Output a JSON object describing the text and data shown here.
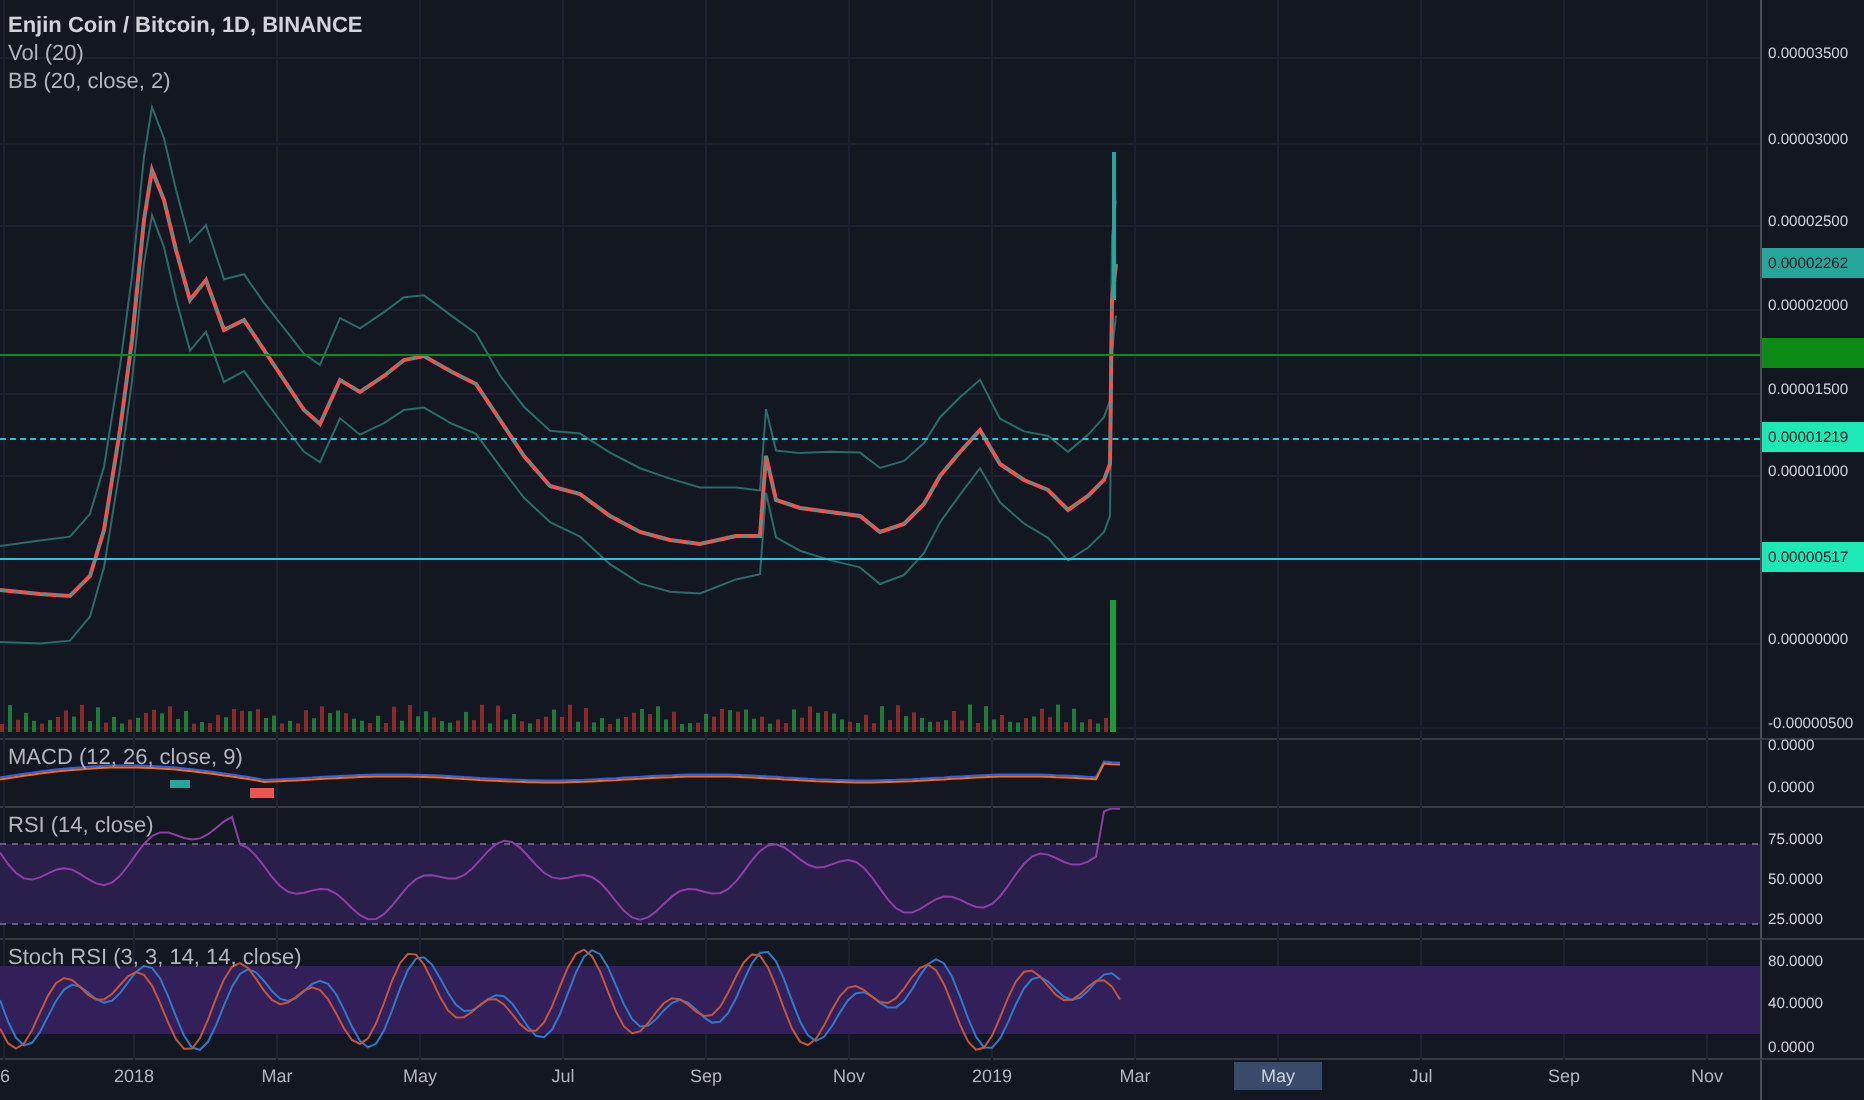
{
  "legend": {
    "title": "Enjin Coin / Bitcoin, 1D, BINANCE",
    "studies": [
      "Vol (20)",
      "BB (20, close, 2)"
    ]
  },
  "price_axis": {
    "ticks": [
      "0.00003500",
      "0.00003000",
      "0.00002500",
      "0.00002000",
      "0.00001500",
      "0.00001000",
      "0.00000000",
      "-0.00000500"
    ]
  },
  "price_lines": [
    {
      "kind": "solid",
      "color": "#0e8a16"
    },
    {
      "kind": "dashed",
      "color": "#26c6da"
    },
    {
      "kind": "solid",
      "color": "#26c6da"
    }
  ],
  "price_tags": [
    {
      "text": "0.00002262",
      "color": "#26a69a"
    },
    {
      "text": "0.00001219",
      "color": "#1de9b6"
    },
    {
      "text": "0.00000517",
      "color": "#1de9b6"
    }
  ],
  "panes": [
    {
      "kind": "macd",
      "label": "MACD (12, 26, close, 9)",
      "ticks": [
        "0.0000",
        "0.0000"
      ]
    },
    {
      "kind": "rsi",
      "label": "RSI (14, close)",
      "ticks": [
        "75.0000",
        "50.0000",
        "25.0000"
      ]
    },
    {
      "kind": "stoch",
      "label": "Stoch RSI (3, 3, 14, 14, close)",
      "ticks": [
        "80.0000",
        "40.0000",
        "0.0000"
      ]
    }
  ],
  "time_axis": [
    {
      "label": "6",
      "selected": false
    },
    {
      "label": "2018",
      "selected": false
    },
    {
      "label": "Mar",
      "selected": false
    },
    {
      "label": "May",
      "selected": false
    },
    {
      "label": "Jul",
      "selected": false
    },
    {
      "label": "Sep",
      "selected": false
    },
    {
      "label": "Nov",
      "selected": false
    },
    {
      "label": "2019",
      "selected": false
    },
    {
      "label": "Mar",
      "selected": false
    },
    {
      "label": "May",
      "selected": true
    },
    {
      "label": "Jul",
      "selected": false
    },
    {
      "label": "Sep",
      "selected": false
    },
    {
      "label": "Nov",
      "selected": false
    }
  ]
}
